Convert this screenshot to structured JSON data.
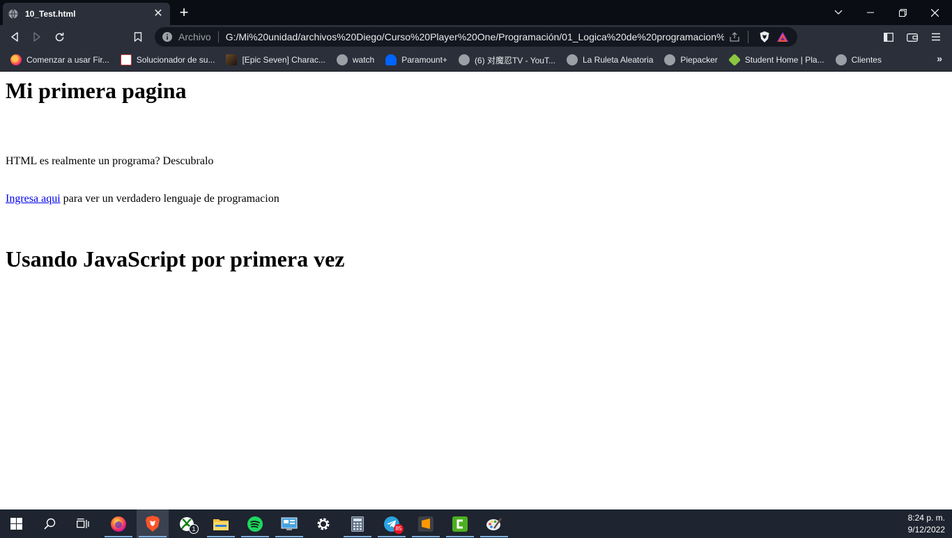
{
  "browser": {
    "tab": {
      "title": "10_Test.html"
    },
    "address_bar": {
      "scheme_label": "Archivo",
      "url": "G:/Mi%20unidad/archivos%20Diego/Curso%20Player%20One/Programación/01_Logica%20de%20programacion%..."
    },
    "bookmarks": [
      {
        "label": "Comenzar a usar Fir...",
        "icon": "firefox-icon"
      },
      {
        "label": "Solucionador de su...",
        "icon": "sudoku-icon"
      },
      {
        "label": "[Epic Seven] Charac...",
        "icon": "epic-seven-icon"
      },
      {
        "label": "watch",
        "icon": "globe-icon"
      },
      {
        "label": "Paramount+",
        "icon": "paramount-icon"
      },
      {
        "label": "(6) 对魔忍TV - YouT...",
        "icon": "globe-icon"
      },
      {
        "label": "La Ruleta Aleatoria",
        "icon": "globe-icon"
      },
      {
        "label": "Piepacker",
        "icon": "globe-icon"
      },
      {
        "label": "Student Home | Pla...",
        "icon": "student-home-icon"
      },
      {
        "label": "Clientes",
        "icon": "globe-icon"
      }
    ],
    "bookmarks_overflow": "»"
  },
  "page": {
    "heading1": "Mi primera pagina",
    "paragraph1": "HTML es realmente un programa? Descubralo",
    "link_text": "Ingresa aqui",
    "paragraph2_rest": " para ver un verdadero lenguaje de programacion",
    "heading2": "Usando JavaScript por primera vez"
  },
  "taskbar": {
    "apps": [
      {
        "name": "windows-start-icon"
      },
      {
        "name": "search-icon"
      },
      {
        "name": "task-view-icon"
      },
      {
        "name": "firefox-icon"
      },
      {
        "name": "brave-icon",
        "active": true
      },
      {
        "name": "xbox-icon",
        "badge": "1"
      },
      {
        "name": "file-explorer-icon"
      },
      {
        "name": "spotify-icon"
      },
      {
        "name": "control-panel-icon"
      },
      {
        "name": "settings-icon"
      },
      {
        "name": "calculator-icon"
      },
      {
        "name": "telegram-icon",
        "badge": "85"
      },
      {
        "name": "sublime-text-icon"
      },
      {
        "name": "camtasia-icon"
      },
      {
        "name": "paint-icon"
      }
    ],
    "time": "8:24 p. m.",
    "date": "9/12/2022"
  },
  "colors": {
    "tabbar_bg": "#0a0d14",
    "toolbar_bg": "#2b2f3a",
    "taskbar_bg": "#1e2430",
    "link": "#0000ee",
    "brave_orange": "#fb542b"
  }
}
